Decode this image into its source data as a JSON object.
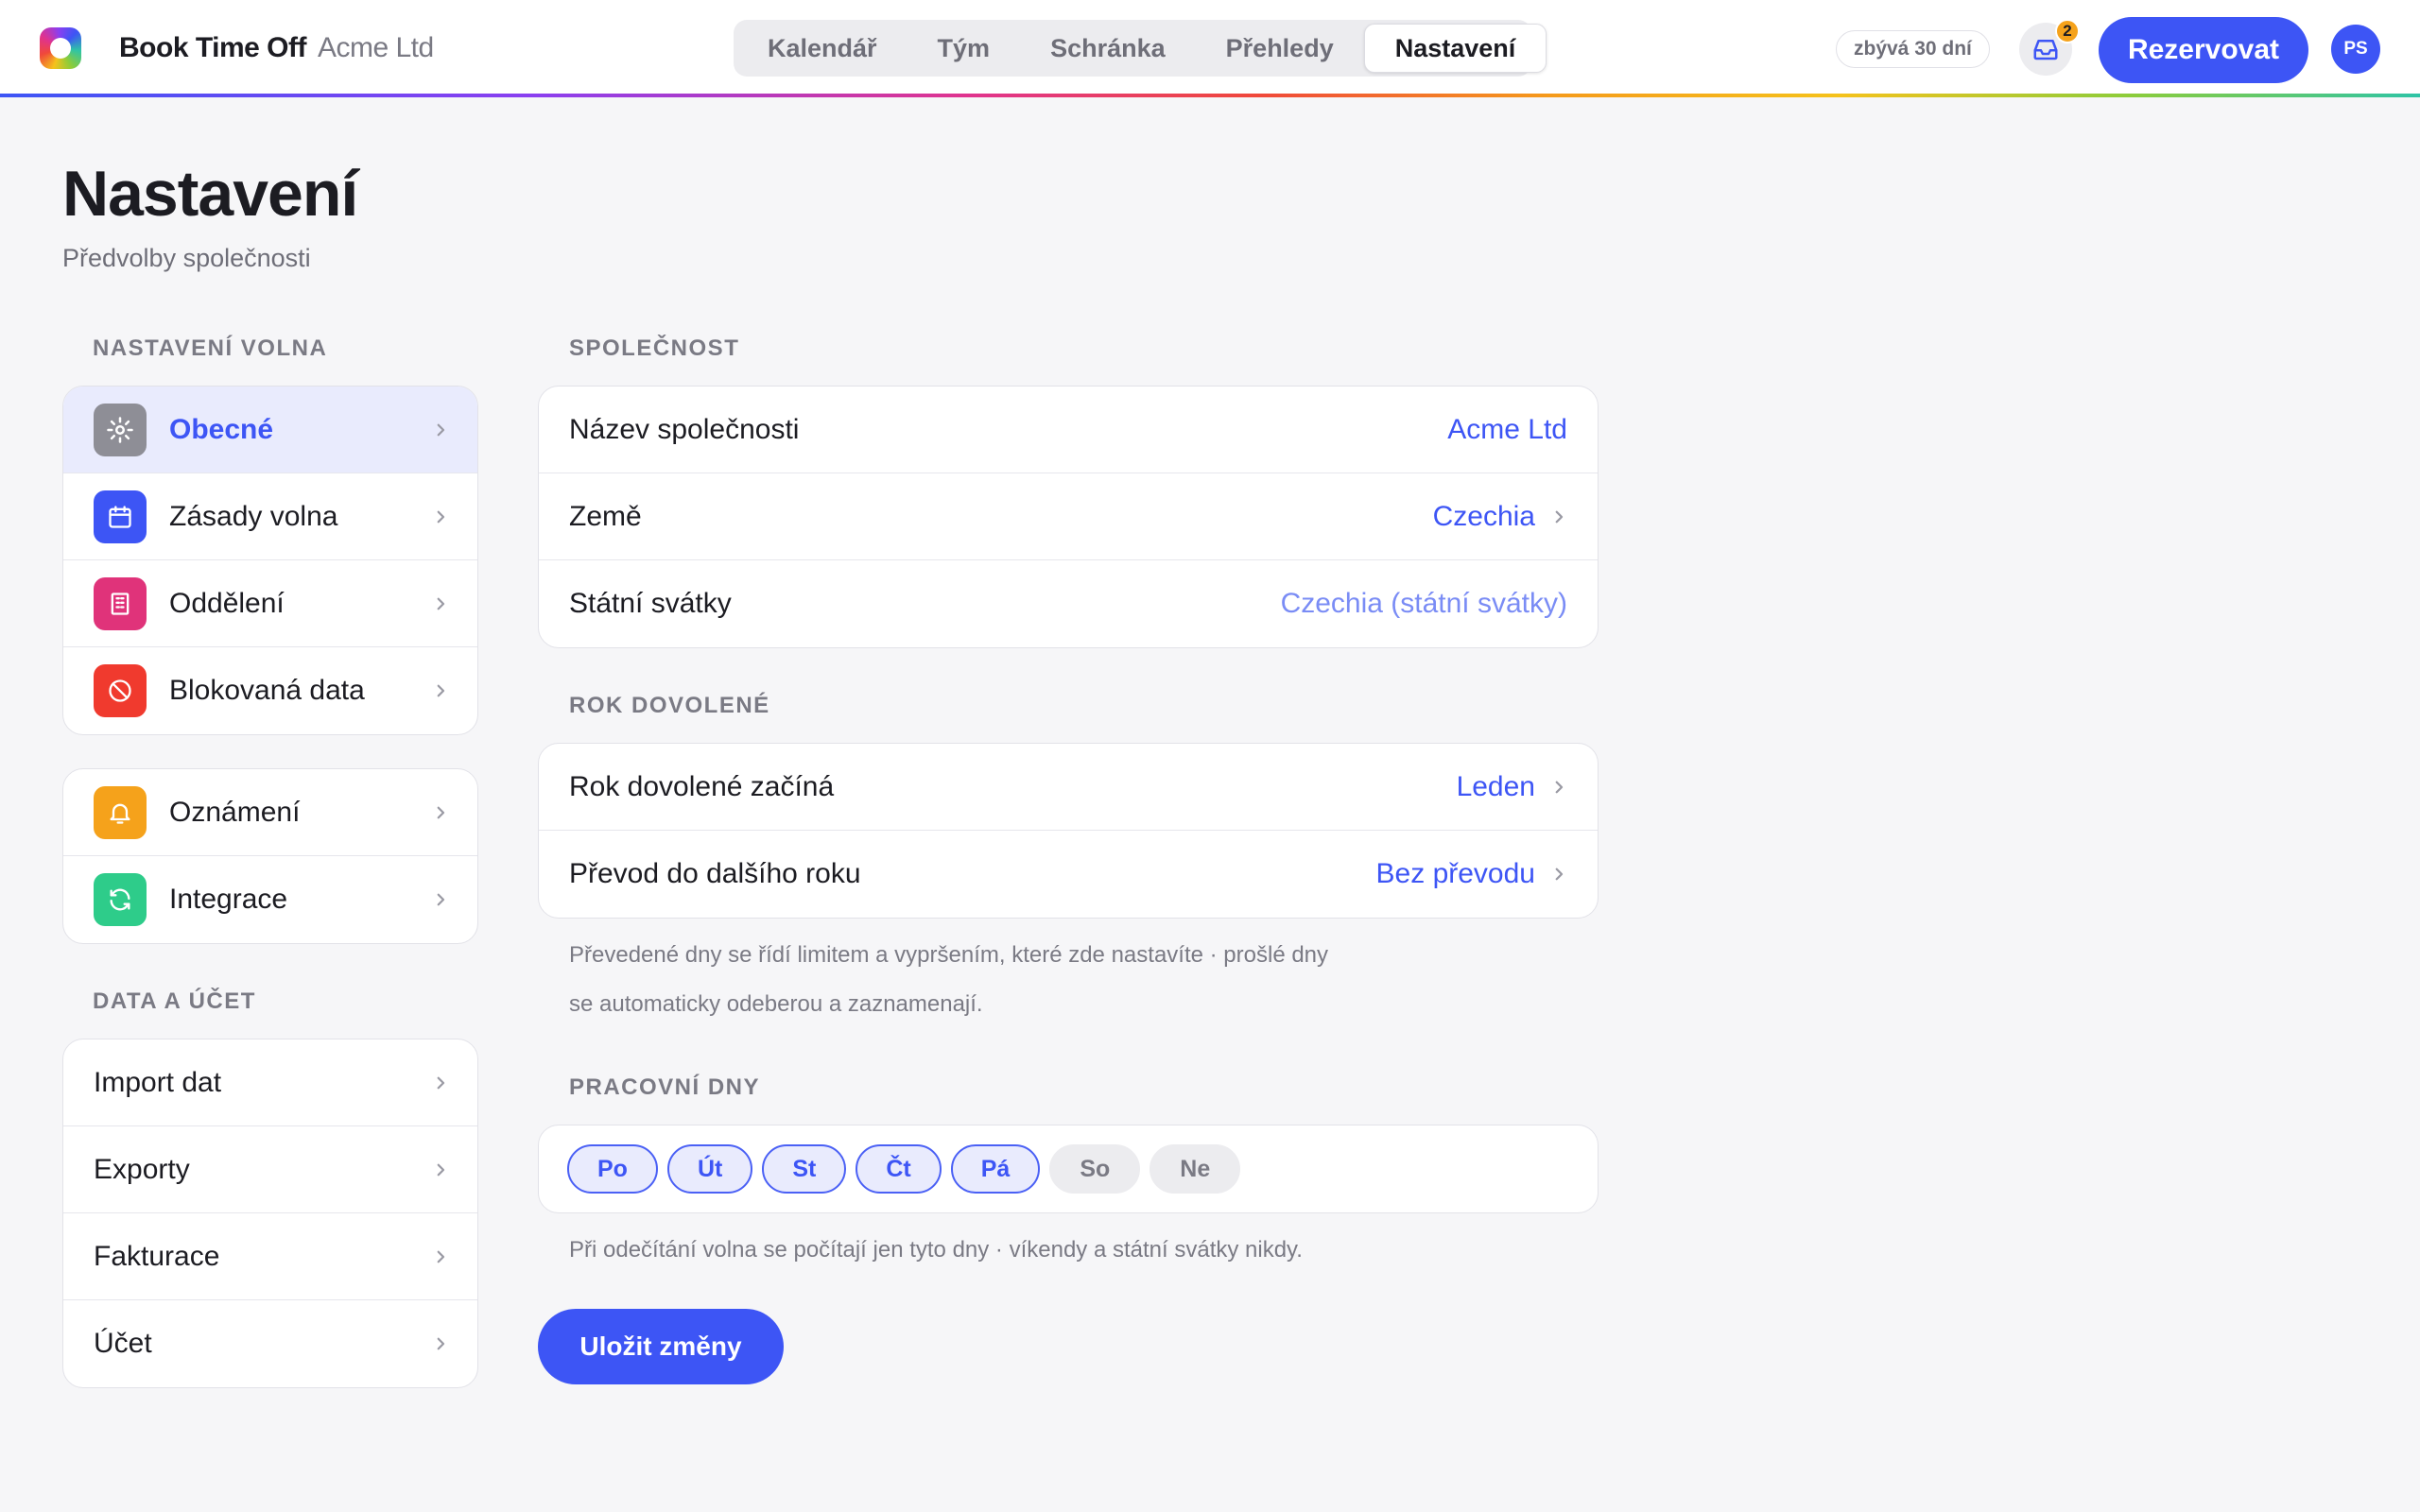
{
  "app": {
    "name": "Book Time Off",
    "company": "Acme Ltd"
  },
  "nav": {
    "tabs": [
      {
        "label": "Kalendář"
      },
      {
        "label": "Tým"
      },
      {
        "label": "Schránka"
      },
      {
        "label": "Přehledy"
      },
      {
        "label": "Nastavení",
        "active": true
      }
    ]
  },
  "header": {
    "trial": "zbývá 30 dní",
    "inbox_count": "2",
    "book_label": "Rezervovat",
    "avatar_initials": "PS"
  },
  "page": {
    "title": "Nastavení",
    "subtitle": "Předvolby společnosti"
  },
  "sidebar": {
    "section1_label": "NASTAVENÍ VOLNA",
    "group1": [
      {
        "label": "Obecné",
        "icon": "gear-icon",
        "color": "#8e8e96",
        "active": true
      },
      {
        "label": "Zásady volna",
        "icon": "calendar-icon",
        "color": "#3d55f5"
      },
      {
        "label": "Oddělení",
        "icon": "building-icon",
        "color": "#e0337a"
      },
      {
        "label": "Blokovaná data",
        "icon": "block-icon",
        "color": "#f03a2e"
      }
    ],
    "group2": [
      {
        "label": "Oznámení",
        "icon": "bell-icon",
        "color": "#f5a21b"
      },
      {
        "label": "Integrace",
        "icon": "sync-icon",
        "color": "#2ecc8a"
      }
    ],
    "section2_label": "DATA A ÚČET",
    "group3": [
      {
        "label": "Import dat"
      },
      {
        "label": "Exporty"
      },
      {
        "label": "Fakturace"
      },
      {
        "label": "Účet"
      }
    ]
  },
  "company": {
    "section_label": "SPOLEČNOST",
    "rows": [
      {
        "label": "Název společnosti",
        "value": "Acme Ltd"
      },
      {
        "label": "Země",
        "value": "Czechia"
      },
      {
        "label": "Státní svátky",
        "value": "Czechia (státní svátky)"
      }
    ]
  },
  "leave_year": {
    "section_label": "ROK DOVOLENÉ",
    "rows": [
      {
        "label": "Rok dovolené začíná",
        "value": "Leden"
      },
      {
        "label": "Převod do dalšího roku",
        "value": "Bez převodu"
      }
    ],
    "note_line1": "Převedené dny se řídí limitem a vypršením, které zde nastavíte · prošlé dny",
    "note_line2": "se automaticky odeberou a zaznamenají."
  },
  "working_days": {
    "section_label": "PRACOVNÍ DNY",
    "days": [
      {
        "label": "Po",
        "on": true
      },
      {
        "label": "Út",
        "on": true
      },
      {
        "label": "St",
        "on": true
      },
      {
        "label": "Čt",
        "on": true
      },
      {
        "label": "Pá",
        "on": true
      },
      {
        "label": "So",
        "on": false
      },
      {
        "label": "Ne",
        "on": false
      }
    ],
    "note": "Při odečítání volna se počítají jen tyto dny · víkendy a státní svátky nikdy."
  },
  "actions": {
    "save_label": "Uložit změny"
  },
  "colors": {
    "accent": "#3d55f5",
    "badge": "#f5a21b"
  }
}
